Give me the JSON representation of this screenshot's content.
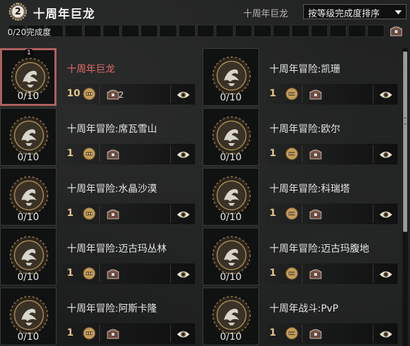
{
  "header": {
    "ap_badge": "2",
    "title": "十周年巨龙",
    "category_label": "十周年巨龙",
    "sort_label": "按等级完成度排序"
  },
  "progress": {
    "text": "0/20完成度",
    "completed": 0,
    "total": 20
  },
  "achievements": [
    {
      "name": "十周年巨龙",
      "count": "0/10",
      "tier": "1",
      "ap": "10",
      "chest_count": "2",
      "selected": true
    },
    {
      "name": "十周年冒险:凯珊",
      "count": "0/10",
      "ap": "1"
    },
    {
      "name": "十周年冒险:席瓦雪山",
      "count": "0/10",
      "ap": "1"
    },
    {
      "name": "十周年冒险:欧尔",
      "count": "0/10",
      "ap": "1"
    },
    {
      "name": "十周年冒险:水晶沙漠",
      "count": "0/10",
      "ap": "1"
    },
    {
      "name": "十周年冒险:科瑞塔",
      "count": "0/10",
      "ap": "1"
    },
    {
      "name": "十周年冒险:迈古玛丛林",
      "count": "0/10",
      "ap": "1"
    },
    {
      "name": "十周年冒险:迈古玛腹地",
      "count": "0/10",
      "ap": "1"
    },
    {
      "name": "十周年冒险:阿斯卡隆",
      "count": "0/10",
      "ap": "1"
    },
    {
      "name": "十周年战斗:PvP",
      "count": "0/10",
      "ap": "1"
    }
  ],
  "colors": {
    "selected_border": "#b16060",
    "selected_name": "#e06a6a",
    "ap_gold": "#e3c48a"
  },
  "icons": {
    "medal": "dragon-medal-icon",
    "coin": "mastery-coin-icon",
    "chest": "reward-chest-icon",
    "eye": "eye-icon"
  }
}
